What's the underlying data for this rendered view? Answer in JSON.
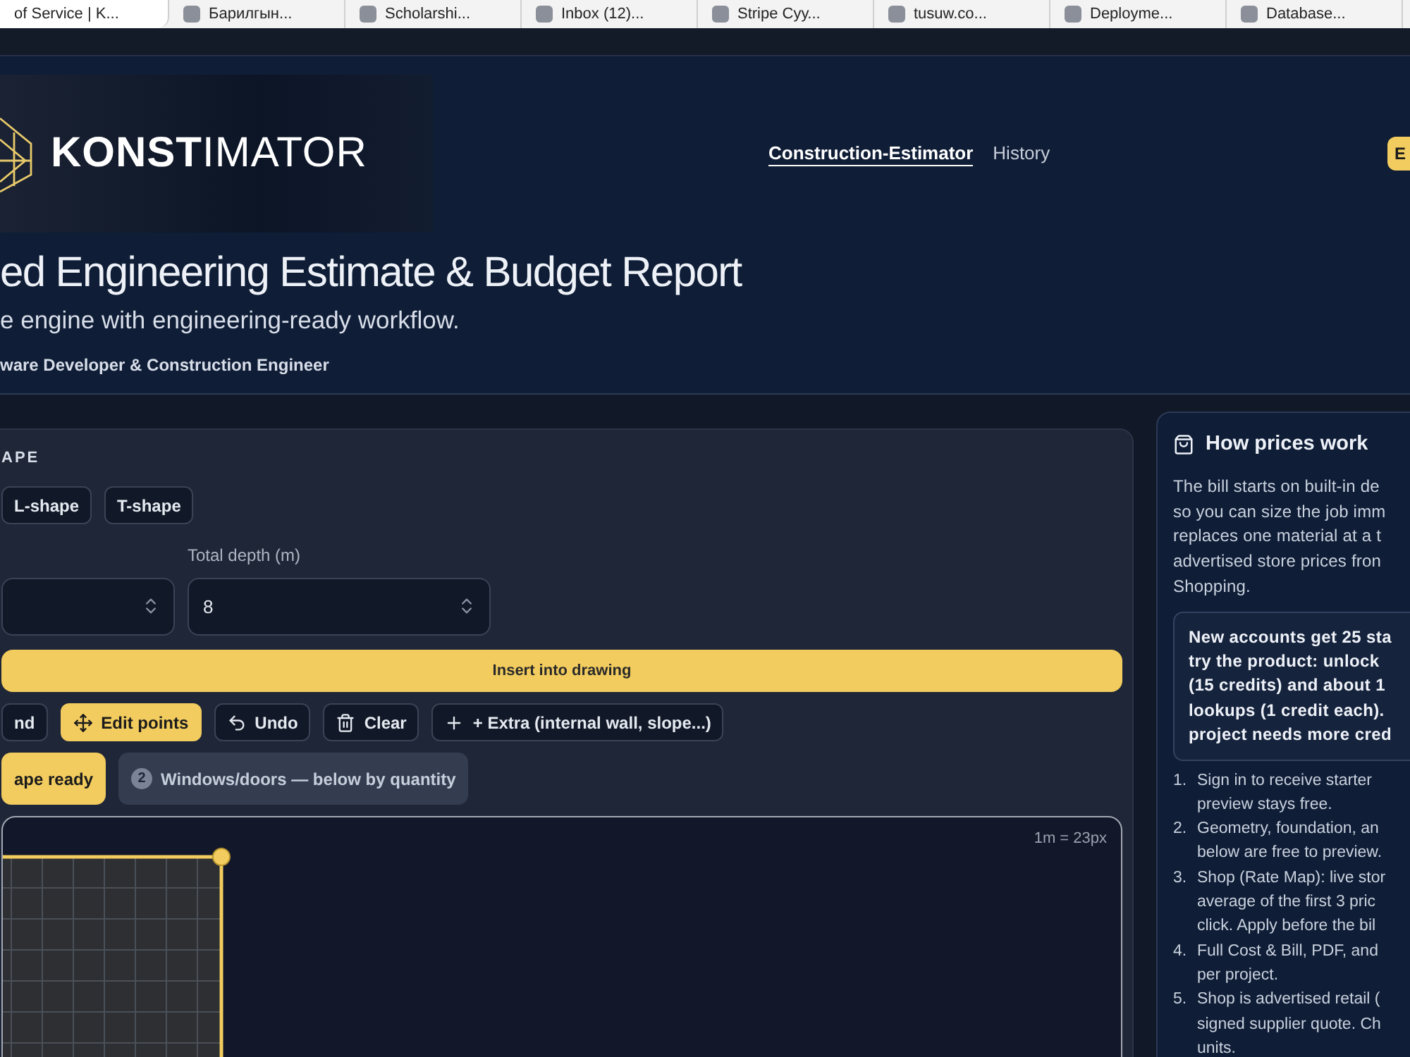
{
  "bookmarks": [
    {
      "title": "of Service | K...",
      "selected": true
    },
    {
      "title": "Барилгын...",
      "selected": false
    },
    {
      "title": "Scholarshi...",
      "selected": false
    },
    {
      "title": "Inbox (12)...",
      "selected": false
    },
    {
      "title": "Stripe Суу...",
      "selected": false
    },
    {
      "title": "tusuw.co...",
      "selected": false
    },
    {
      "title": "Deployme...",
      "selected": false
    },
    {
      "title": "Database...",
      "selected": false
    }
  ],
  "header": {
    "logo": "**KONST**IMATOR",
    "nav": [
      {
        "label": "Construction-Estimator",
        "selected": true
      },
      {
        "label": "History",
        "selected": false
      }
    ],
    "button": "E"
  },
  "hero": {
    "title": "ed Engineering Estimate & Budget Report",
    "subtitle": "e engine with engineering-ready workflow.",
    "author": "ware Developer & Construction Engineer"
  },
  "shape_panel": {
    "section_label": "APE",
    "shape_options": [
      {
        "label": "L-shape",
        "selected": false
      },
      {
        "label": "T-shape",
        "selected": false
      }
    ],
    "fields": [
      {
        "kind": "number"
      },
      {
        "kind": "number",
        "label": "Total depth (m)",
        "value": "8"
      }
    ],
    "insert_button": "Insert into drawing",
    "tools": [
      {
        "label": "nd",
        "kind": "text",
        "selected": false
      },
      {
        "label": "Edit points",
        "kind": "move",
        "selected": true
      },
      {
        "label": "Undo",
        "kind": "undo",
        "selected": false
      },
      {
        "label": "Clear",
        "kind": "trash",
        "selected": false
      },
      {
        "label": "+ Extra (internal wall, slope...)",
        "kind": "add",
        "selected": false
      }
    ],
    "steps": [
      {
        "label": "ape ready",
        "done": true
      },
      {
        "number": "2",
        "label": "Windows/doors — below by quantity",
        "done": false
      }
    ],
    "canvas": {
      "scale": "1m = 23px"
    }
  },
  "prices": {
    "title": "How prices work",
    "paragraph": [
      "The bill starts on built-in de",
      "so you can size the job imm",
      "replaces one material at a t",
      "advertised store prices fron",
      "Shopping."
    ],
    "note": [
      "New accounts get 25 sta",
      "try the product: unlock",
      "(15 credits) and about 1",
      "lookups (1 credit each).",
      "project needs more cred"
    ],
    "steps": [
      {
        "number": "1.",
        "lines": [
          "Sign in to receive starter",
          "preview stays free."
        ]
      },
      {
        "number": "2.",
        "lines": [
          "Geometry, foundation, an",
          "below are free to preview."
        ]
      },
      {
        "number": "3.",
        "lines": [
          "Shop (Rate Map): live stor",
          "average of the first 3 pric",
          "click. Apply before the bil"
        ]
      },
      {
        "number": "4.",
        "lines": [
          "Full Cost & Bill, PDF, and",
          "per project."
        ]
      },
      {
        "number": "5.",
        "lines": [
          "Shop is advertised retail (",
          "signed supplier quote. Ch",
          "units."
        ]
      }
    ]
  }
}
